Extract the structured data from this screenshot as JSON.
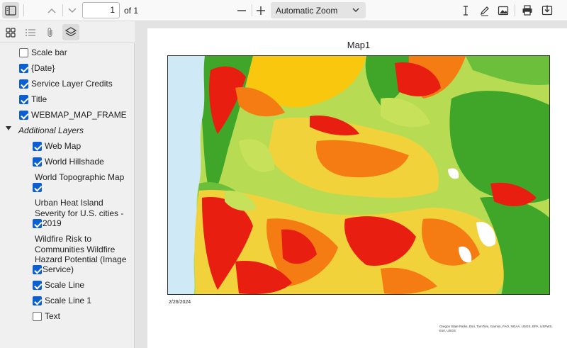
{
  "toolbar": {
    "page_number": "1",
    "page_of": "of 1",
    "zoom_label": "Automatic Zoom"
  },
  "sidebar": {
    "layers": [
      {
        "label": "Scale bar",
        "checked": false
      },
      {
        "label": "{Date}",
        "checked": true
      },
      {
        "label": "Service Layer Credits",
        "checked": true
      },
      {
        "label": "Title",
        "checked": true
      },
      {
        "label": "WEBMAP_MAP_FRAME",
        "checked": true
      }
    ],
    "group_label": "Additional Layers",
    "sublayers": [
      {
        "label": "Web Map",
        "checked": true
      },
      {
        "label": "World Hillshade",
        "checked": true
      },
      {
        "label": "World Topographic Map",
        "checked": true
      },
      {
        "label": "Urban Heat Island Severity for U.S. cities - 2019",
        "line1": "Urban Heat Island",
        "line2": "Severity for U.S. cities -",
        "line3": "2019",
        "checked": true
      },
      {
        "label": "Wildfire Risk to Communities Wildfire Hazard Potential (Image Service)",
        "line1": "Wildfire Risk to",
        "line2": "Communities Wildfire",
        "line3": "Hazard Potential (Image",
        "line4": "Service)",
        "checked": true
      },
      {
        "label": "Scale Line",
        "checked": true
      },
      {
        "label": "Scale Line 1",
        "checked": true
      },
      {
        "label": "Text",
        "checked": false
      }
    ]
  },
  "document": {
    "map_title": "Map1",
    "date_text": "2/26/2024",
    "credits_text": "Oregon State Parks, Esri, TomTom, Garmin, FAO, NOAA, USGS, EPA, USFWS, Esri, USGS"
  },
  "colors": {
    "accent": "#0b5fd0",
    "hazard_very_high": "#e81e10",
    "hazard_high": "#f57c12",
    "hazard_moderate": "#f9c80e",
    "hazard_low": "#c7e25a",
    "hazard_very_low": "#3fa62a",
    "water": "#cfe9f7"
  },
  "icons": [
    "sidebar-toggle-icon",
    "chevron-up-icon",
    "chevron-down-icon",
    "minus-icon",
    "plus-icon",
    "text-cursor-icon",
    "draw-icon",
    "image-icon",
    "print-icon",
    "save-icon",
    "thumbnails-icon",
    "outline-icon",
    "attachments-icon",
    "layers-icon"
  ]
}
